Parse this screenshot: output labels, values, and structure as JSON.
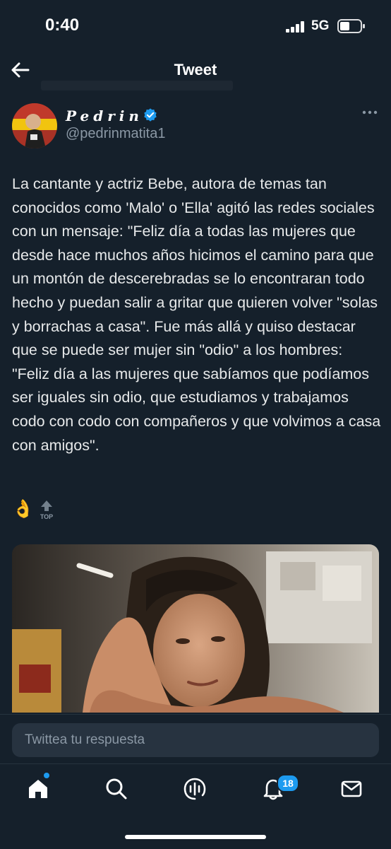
{
  "status_bar": {
    "time": "0:40",
    "network": "5G"
  },
  "nav": {
    "title": "Tweet"
  },
  "author": {
    "display_name": "Pedrin",
    "handle": "@pedrinmatita1"
  },
  "tweet": {
    "text": "La cantante y actriz Bebe, autora de temas tan conocidos como 'Malo' o 'Ella' agitó las redes sociales con un mensaje: \"Feliz día a todas las mujeres que desde hace muchos años hicimos el camino para que un montón de descerebradas se lo encontraran todo hecho y puedan salir a gritar que quieren volver \"solas y borrachas a casa\". Fue más allá y quiso destacar que se puede ser mujer sin \"odio\" a los hombres: \"Feliz día a las mujeres que sabíamos que podíamos ser iguales sin odio, que estudiamos y trabajamos codo con codo con compañeros y que volvimos a casa con amigos\".",
    "emoji": "👌",
    "top_badge": "TOP"
  },
  "reply": {
    "placeholder": "Twittea tu respuesta"
  },
  "tabbar": {
    "items": [
      {
        "icon": "home-icon"
      },
      {
        "icon": "search-icon"
      },
      {
        "icon": "spaces-icon"
      },
      {
        "icon": "bell-icon"
      },
      {
        "icon": "mail-icon"
      }
    ],
    "notifications_count": "18"
  },
  "colors": {
    "background": "#15202b",
    "accent": "#1d9bf0",
    "secondary_text": "#8b98a5"
  }
}
